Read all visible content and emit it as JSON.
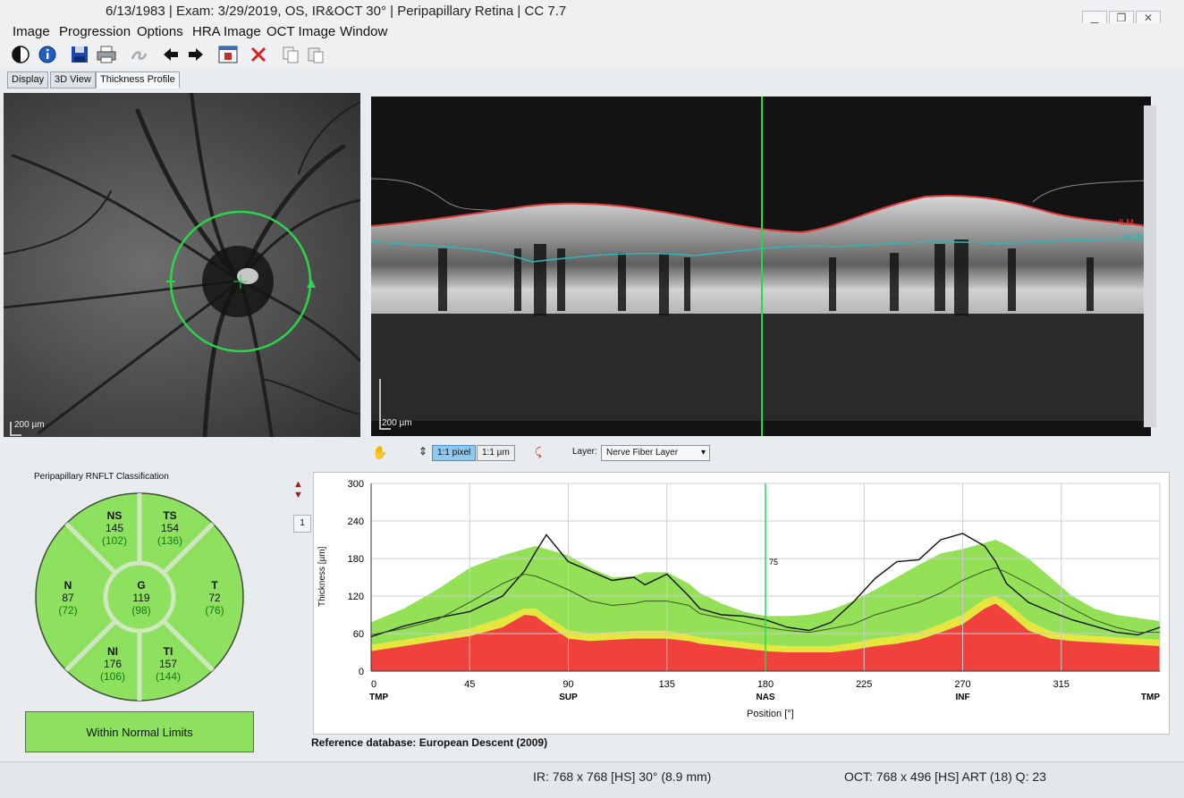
{
  "window": {
    "title": "6/13/1983  |  Exam: 3/29/2019, OS, IR&OCT 30°  |  Peripapillary Retina  |  CC 7.7",
    "controls": [
      "▁",
      "❐",
      "✕"
    ]
  },
  "menu": [
    "Image",
    "Progression",
    "Options",
    "HRA Image",
    "OCT Image",
    "Window"
  ],
  "toolbar": [
    "contrast-icon",
    "info-icon",
    "save-icon",
    "print-icon",
    "edit-icon",
    "back-arrow-icon",
    "forward-arrow-icon",
    "report-icon",
    "delete-icon",
    "copy-icon",
    "paste-icon"
  ],
  "tabs": [
    {
      "label": "Display",
      "active": false
    },
    {
      "label": "3D View",
      "active": false
    },
    {
      "label": "Thickness Profile",
      "active": true
    }
  ],
  "fundus": {
    "scale_label": "200 µm"
  },
  "oct": {
    "scale_label": "200 µm",
    "layer_labels": [
      "ILM",
      "RNFL"
    ]
  },
  "controls": {
    "btn_pixel": "1:1 pixel",
    "btn_um": "1:1 µm",
    "layer_label": "Layer:",
    "layer_value": "Nerve Fiber Layer"
  },
  "classification": {
    "title": "Peripapillary RNFLT Classification",
    "sectors": [
      {
        "name": "NS",
        "value": "145",
        "ref": "(102)"
      },
      {
        "name": "TS",
        "value": "154",
        "ref": "(136)"
      },
      {
        "name": "N",
        "value": "87",
        "ref": "(72)"
      },
      {
        "name": "G",
        "value": "119",
        "ref": "(98)"
      },
      {
        "name": "T",
        "value": "72",
        "ref": "(76)"
      },
      {
        "name": "NI",
        "value": "176",
        "ref": "(106)"
      },
      {
        "name": "TI",
        "value": "157",
        "ref": "(144)"
      }
    ],
    "result": "Within Normal Limits",
    "selected_index": "1"
  },
  "chart_data": {
    "type": "line",
    "ylabel": "Thickness [µm]",
    "xlabel": "Position [°]",
    "xlim": [
      0,
      360
    ],
    "ylim": [
      0,
      300
    ],
    "xticks": [
      0,
      45,
      90,
      135,
      180,
      225,
      270,
      315
    ],
    "yticks": [
      0,
      60,
      120,
      180,
      240,
      300
    ],
    "region_labels": [
      {
        "x": 0,
        "label": "TMP"
      },
      {
        "x": 90,
        "label": "SUP"
      },
      {
        "x": 180,
        "label": "NAS"
      },
      {
        "x": 270,
        "label": "INF"
      },
      {
        "x": 360,
        "label": "TMP"
      }
    ],
    "cursor": {
      "x": 180,
      "label": "75"
    },
    "x": [
      0,
      15,
      30,
      45,
      60,
      70,
      75,
      80,
      90,
      100,
      110,
      120,
      125,
      135,
      145,
      150,
      160,
      170,
      180,
      190,
      200,
      210,
      220,
      230,
      240,
      250,
      260,
      270,
      280,
      285,
      290,
      300,
      310,
      320,
      330,
      340,
      350,
      360
    ],
    "series": [
      {
        "name": "Patient",
        "values": [
          55,
          72,
          85,
          95,
          120,
          160,
          190,
          218,
          175,
          160,
          145,
          150,
          138,
          155,
          120,
          100,
          90,
          88,
          82,
          70,
          65,
          78,
          110,
          148,
          175,
          178,
          210,
          220,
          200,
          175,
          140,
          110,
          95,
          82,
          72,
          62,
          58,
          70
        ]
      },
      {
        "name": "Normal mean",
        "values": [
          58,
          68,
          82,
          110,
          140,
          155,
          152,
          145,
          130,
          112,
          105,
          108,
          112,
          112,
          105,
          92,
          85,
          78,
          70,
          65,
          62,
          68,
          75,
          90,
          100,
          110,
          125,
          145,
          160,
          165,
          158,
          140,
          120,
          100,
          82,
          70,
          62,
          62
        ]
      }
    ],
    "bands": {
      "red_upper": [
        32,
        40,
        48,
        56,
        70,
        90,
        88,
        75,
        52,
        48,
        50,
        52,
        52,
        52,
        48,
        44,
        40,
        36,
        32,
        30,
        30,
        30,
        34,
        40,
        44,
        50,
        62,
        75,
        100,
        108,
        95,
        65,
        52,
        48,
        46,
        44,
        42,
        40
      ],
      "yellow_upper": [
        42,
        50,
        58,
        68,
        85,
        100,
        100,
        88,
        65,
        60,
        62,
        64,
        64,
        64,
        58,
        54,
        50,
        46,
        42,
        40,
        40,
        40,
        45,
        52,
        56,
        62,
        75,
        90,
        115,
        120,
        110,
        80,
        64,
        58,
        56,
        54,
        52,
        50
      ],
      "green_upper": [
        78,
        100,
        130,
        165,
        185,
        195,
        200,
        195,
        185,
        165,
        150,
        152,
        158,
        158,
        140,
        125,
        108,
        95,
        88,
        88,
        90,
        98,
        112,
        130,
        150,
        170,
        188,
        195,
        205,
        210,
        202,
        180,
        150,
        120,
        100,
        90,
        85,
        80
      ]
    }
  },
  "reference": "Reference database: European Descent (2009)",
  "status": {
    "ir": "IR: 768 x 768 [HS] 30° (8.9 mm)",
    "oct": "OCT: 768 x 496 [HS] ART (18) Q: 23"
  }
}
